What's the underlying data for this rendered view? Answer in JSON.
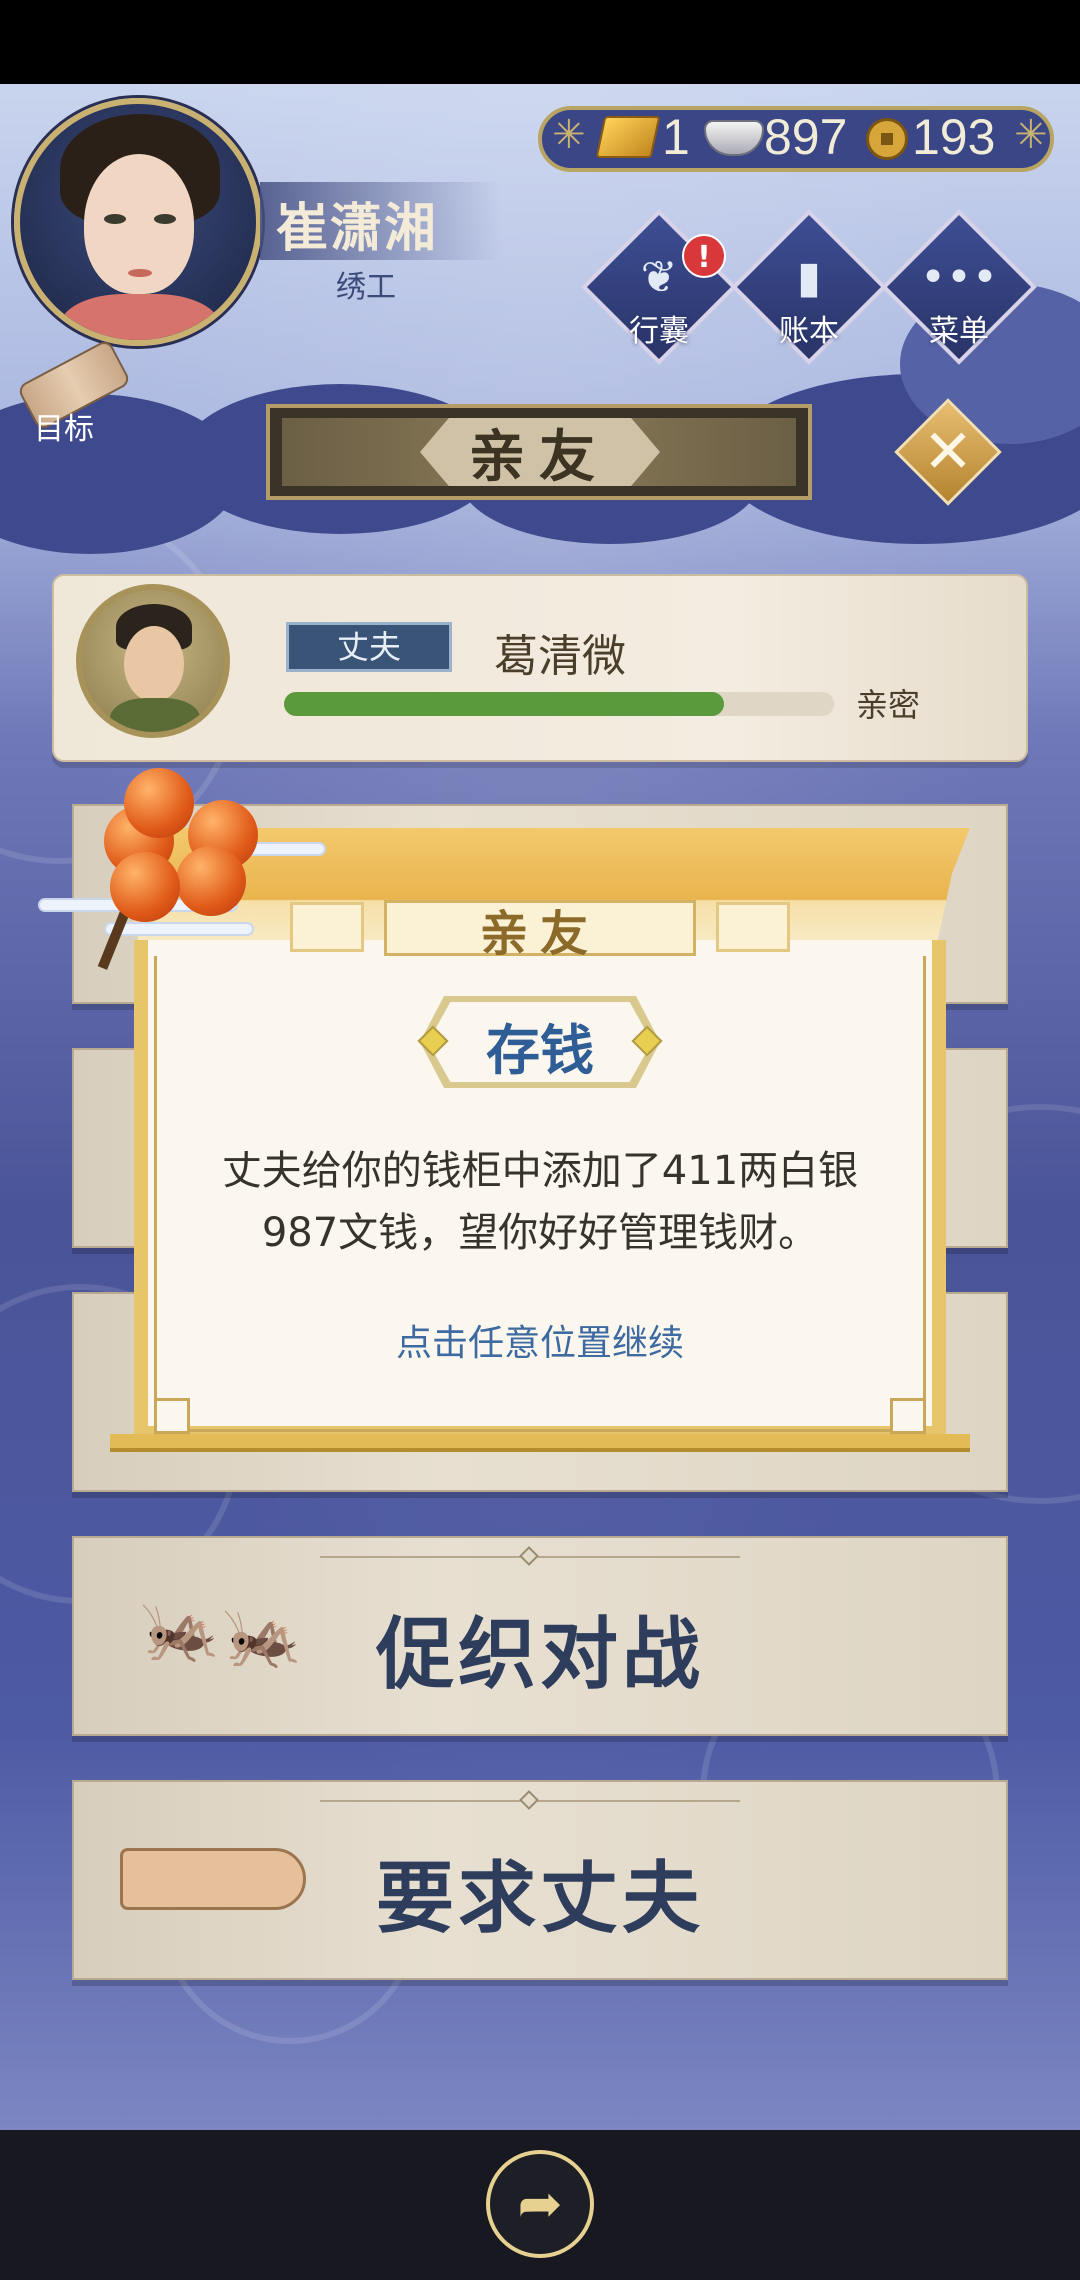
{
  "player": {
    "name": "崔潇湘",
    "title": "绣工"
  },
  "currency": {
    "gold": "1",
    "silver": "897",
    "coins": "193"
  },
  "top_menu": {
    "items": [
      {
        "label": "行囊",
        "icon": "bag-icon",
        "badge": "!"
      },
      {
        "label": "账本",
        "icon": "ledger-icon"
      },
      {
        "label": "菜单",
        "icon": "more-icon"
      }
    ],
    "goal_label": "目标"
  },
  "page": {
    "title": "亲友"
  },
  "relative": {
    "role": "丈夫",
    "name": "葛清微",
    "status": "亲密",
    "affection": 0.8
  },
  "menu_rows": [
    {
      "label": "促织对战"
    },
    {
      "label": "要求丈夫"
    }
  ],
  "dialog": {
    "header": "亲友",
    "subtitle": "存钱",
    "message_line1": "丈夫给你的钱柜中添加了411两白银",
    "message_line2": "987文钱，望你好好管理钱财。",
    "continue_hint": "点击任意位置继续"
  },
  "colors": {
    "accent_gold": "#e7c56a",
    "title_blue": "#2f5d96",
    "progress_green": "#5a9a3c"
  }
}
